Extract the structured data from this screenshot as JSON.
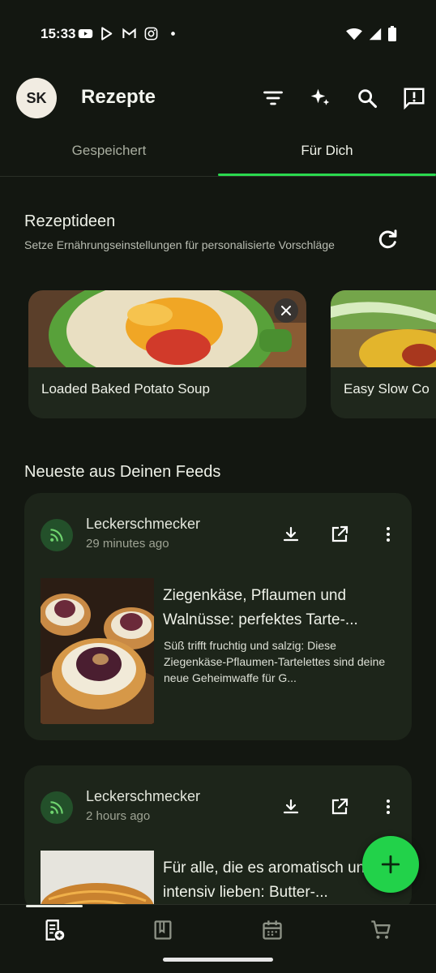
{
  "status_bar": {
    "time": "15:33",
    "notification_icons": [
      "youtube-icon",
      "play-store-icon",
      "gmail-icon",
      "instagram-icon",
      "dot-icon"
    ],
    "system_icons": [
      "wifi-icon",
      "signal-icon",
      "battery-icon"
    ]
  },
  "app_bar": {
    "avatar_initials": "SK",
    "title": "Rezepte",
    "actions": [
      "filter-icon",
      "sparkle-icon",
      "search-icon",
      "feedback-icon"
    ]
  },
  "tabs": [
    {
      "label": "Gespeichert",
      "active": false
    },
    {
      "label": "Für Dich",
      "active": true
    }
  ],
  "ideas": {
    "title": "Rezeptideen",
    "subtitle": "Setze Ernährungseinstellungen für personalisierte Vorschläge",
    "cards": [
      {
        "label": "Loaded Baked Potato Soup"
      },
      {
        "label": "Easy Slow Co"
      }
    ]
  },
  "feeds": {
    "title": "Neueste aus Deinen Feeds",
    "items": [
      {
        "source": "Leckerschmecker",
        "time": "29 minutes ago",
        "headline": "Ziegenkäse, Pflaumen und Walnüsse: perfektes Tarte-...",
        "excerpt": "Süß trifft fruchtig und salzig: Diese Ziegenkäse-Pflaumen-Tartelettes sind deine neue Geheimwaffe für G..."
      },
      {
        "source": "Leckerschmecker",
        "time": "2 hours ago",
        "headline": "Für alle, die es aromatisch und intensiv lieben: Butter-...",
        "excerpt": ""
      }
    ]
  },
  "bottom_nav": [
    "recipe-add-icon",
    "book-icon",
    "calendar-icon",
    "cart-icon"
  ],
  "colors": {
    "background": "#131711",
    "card": "#1d251a",
    "accent": "#22d24a",
    "feed_icon_bg": "#23502a"
  }
}
